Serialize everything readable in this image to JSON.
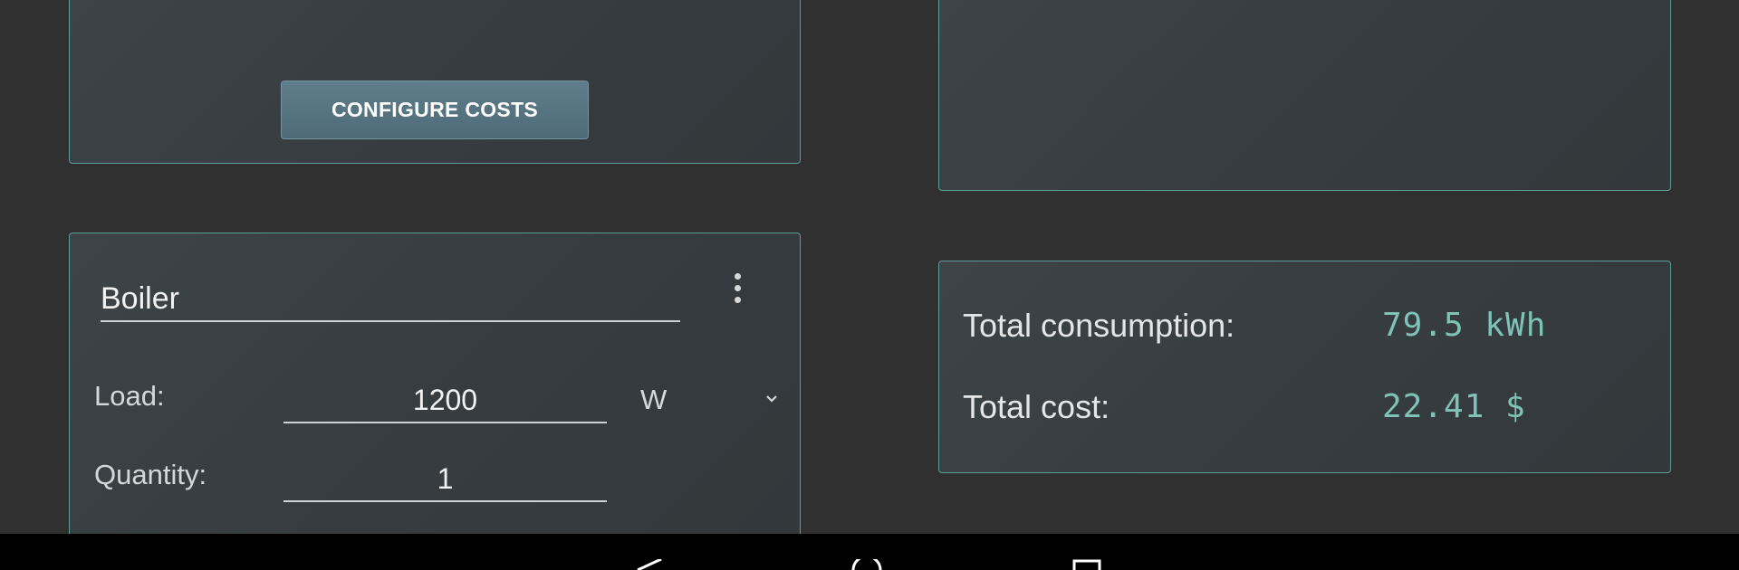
{
  "costs_card": {
    "configure_button_label": "CONFIGURE COSTS"
  },
  "device": {
    "name": "Boiler",
    "load_label": "Load:",
    "load_value": "1200",
    "load_unit": "W",
    "quantity_label": "Quantity:",
    "quantity_value": "1"
  },
  "totals": {
    "consumption_label": "Total consumption:",
    "consumption_value": "79.5 kWh",
    "cost_label": "Total cost:",
    "cost_value": "22.41 $"
  },
  "colors": {
    "background": "#303030",
    "card_border": "#5f9c98",
    "accent_value": "#7fc3b8",
    "button": "#587583"
  },
  "icons": {
    "menu": "more-vert-icon",
    "unit_dropdown": "chevron-down-icon",
    "nav_back": "back-icon",
    "nav_home": "home-icon",
    "nav_recents": "recents-icon"
  }
}
